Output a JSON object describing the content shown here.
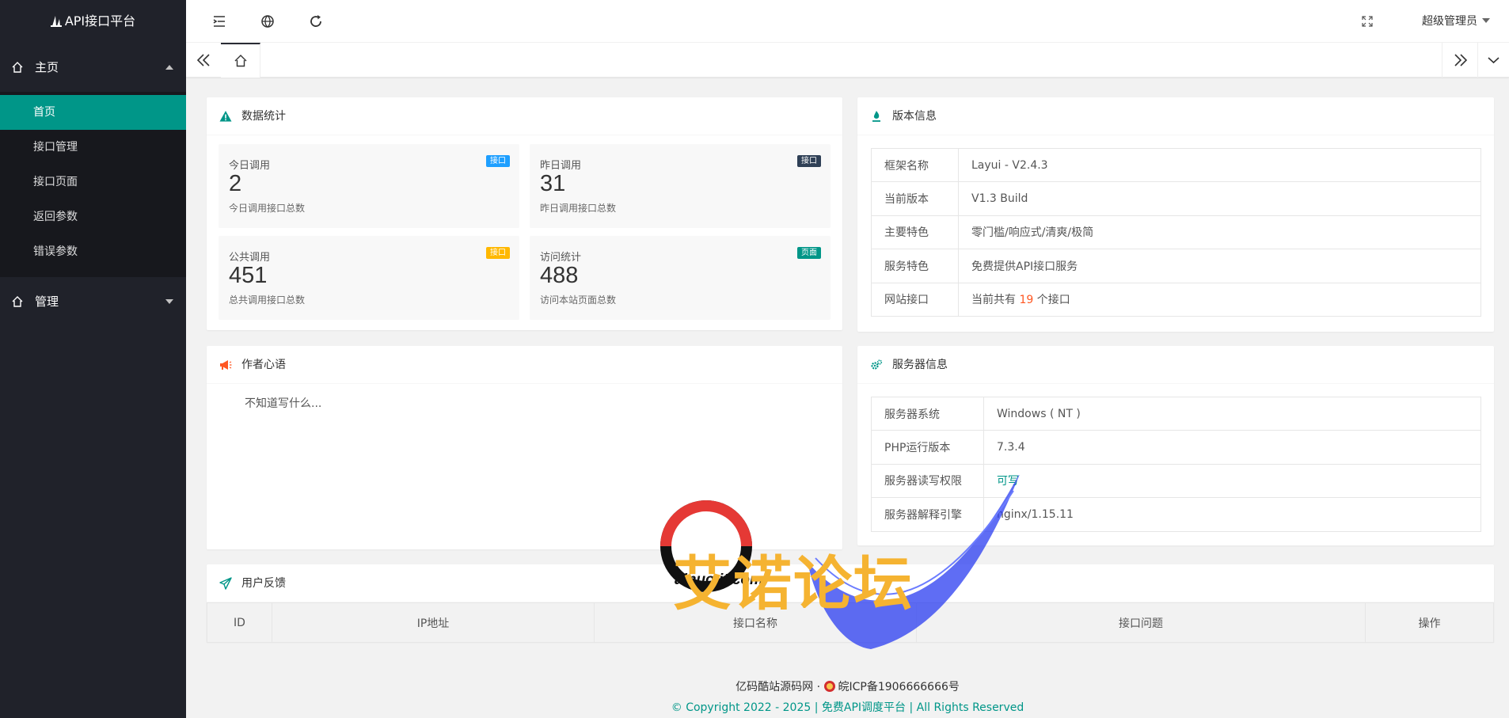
{
  "app": {
    "title": "API接口平台"
  },
  "sidebar": {
    "groups": [
      {
        "label": "主页",
        "items": [
          "首页",
          "接口管理",
          "接口页面",
          "返回参数",
          "错误参数"
        ]
      },
      {
        "label": "管理"
      }
    ]
  },
  "header": {
    "user": "超级管理员"
  },
  "stats_card": {
    "title": "数据统计",
    "items": [
      {
        "title": "今日调用",
        "value": "2",
        "desc": "今日调用接口总数",
        "badge": "接口",
        "badge_color": "#1e9fff"
      },
      {
        "title": "昨日调用",
        "value": "31",
        "desc": "昨日调用接口总数",
        "badge": "接口",
        "badge_color": "#2f4056"
      },
      {
        "title": "公共调用",
        "value": "451",
        "desc": "总共调用接口总数",
        "badge": "接口",
        "badge_color": "#ffb800"
      },
      {
        "title": "访问统计",
        "value": "488",
        "desc": "访问本站页面总数",
        "badge": "页面",
        "badge_color": "#009688"
      }
    ]
  },
  "version_card": {
    "title": "版本信息",
    "rows": [
      {
        "k": "框架名称",
        "v": "Layui - V2.4.3"
      },
      {
        "k": "当前版本",
        "v": "V1.3 Build"
      },
      {
        "k": "主要特色",
        "v": "零门槛/响应式/清爽/极简"
      },
      {
        "k": "服务特色",
        "v": "免费提供API接口服务"
      }
    ],
    "api_row": {
      "k": "网站接口",
      "prefix": "当前共有",
      "count": "19",
      "suffix": "个接口"
    }
  },
  "author_card": {
    "title": "作者心语",
    "text": "不知道写什么..."
  },
  "server_card": {
    "title": "服务器信息",
    "rows": [
      {
        "k": "服务器系统",
        "v": "Windows ( NT )"
      },
      {
        "k": "PHP运行版本",
        "v": "7.3.4"
      },
      {
        "k": "服务器读写权限",
        "v": "可写"
      },
      {
        "k": "服务器解释引擎",
        "v": "nginx/1.15.11"
      }
    ]
  },
  "feedback_card": {
    "title": "用户反馈",
    "columns": [
      "ID",
      "IP地址",
      "接口名称",
      "接口问题",
      "操作"
    ]
  },
  "watermark": {
    "text": "艾诺论坛",
    "url": "ainuo.it.com"
  },
  "footer": {
    "line1_site": "亿码酷站源码网",
    "line1_sep": "·",
    "line1_icp": "皖ICP备1906666666号",
    "line2": "© Copyright 2022 - 2025 | 免费API调度平台 | All Rights Reserved"
  },
  "colors": {
    "accent": "#009688",
    "sidebar_bg": "#20222a",
    "highlight": "#ff5722"
  }
}
